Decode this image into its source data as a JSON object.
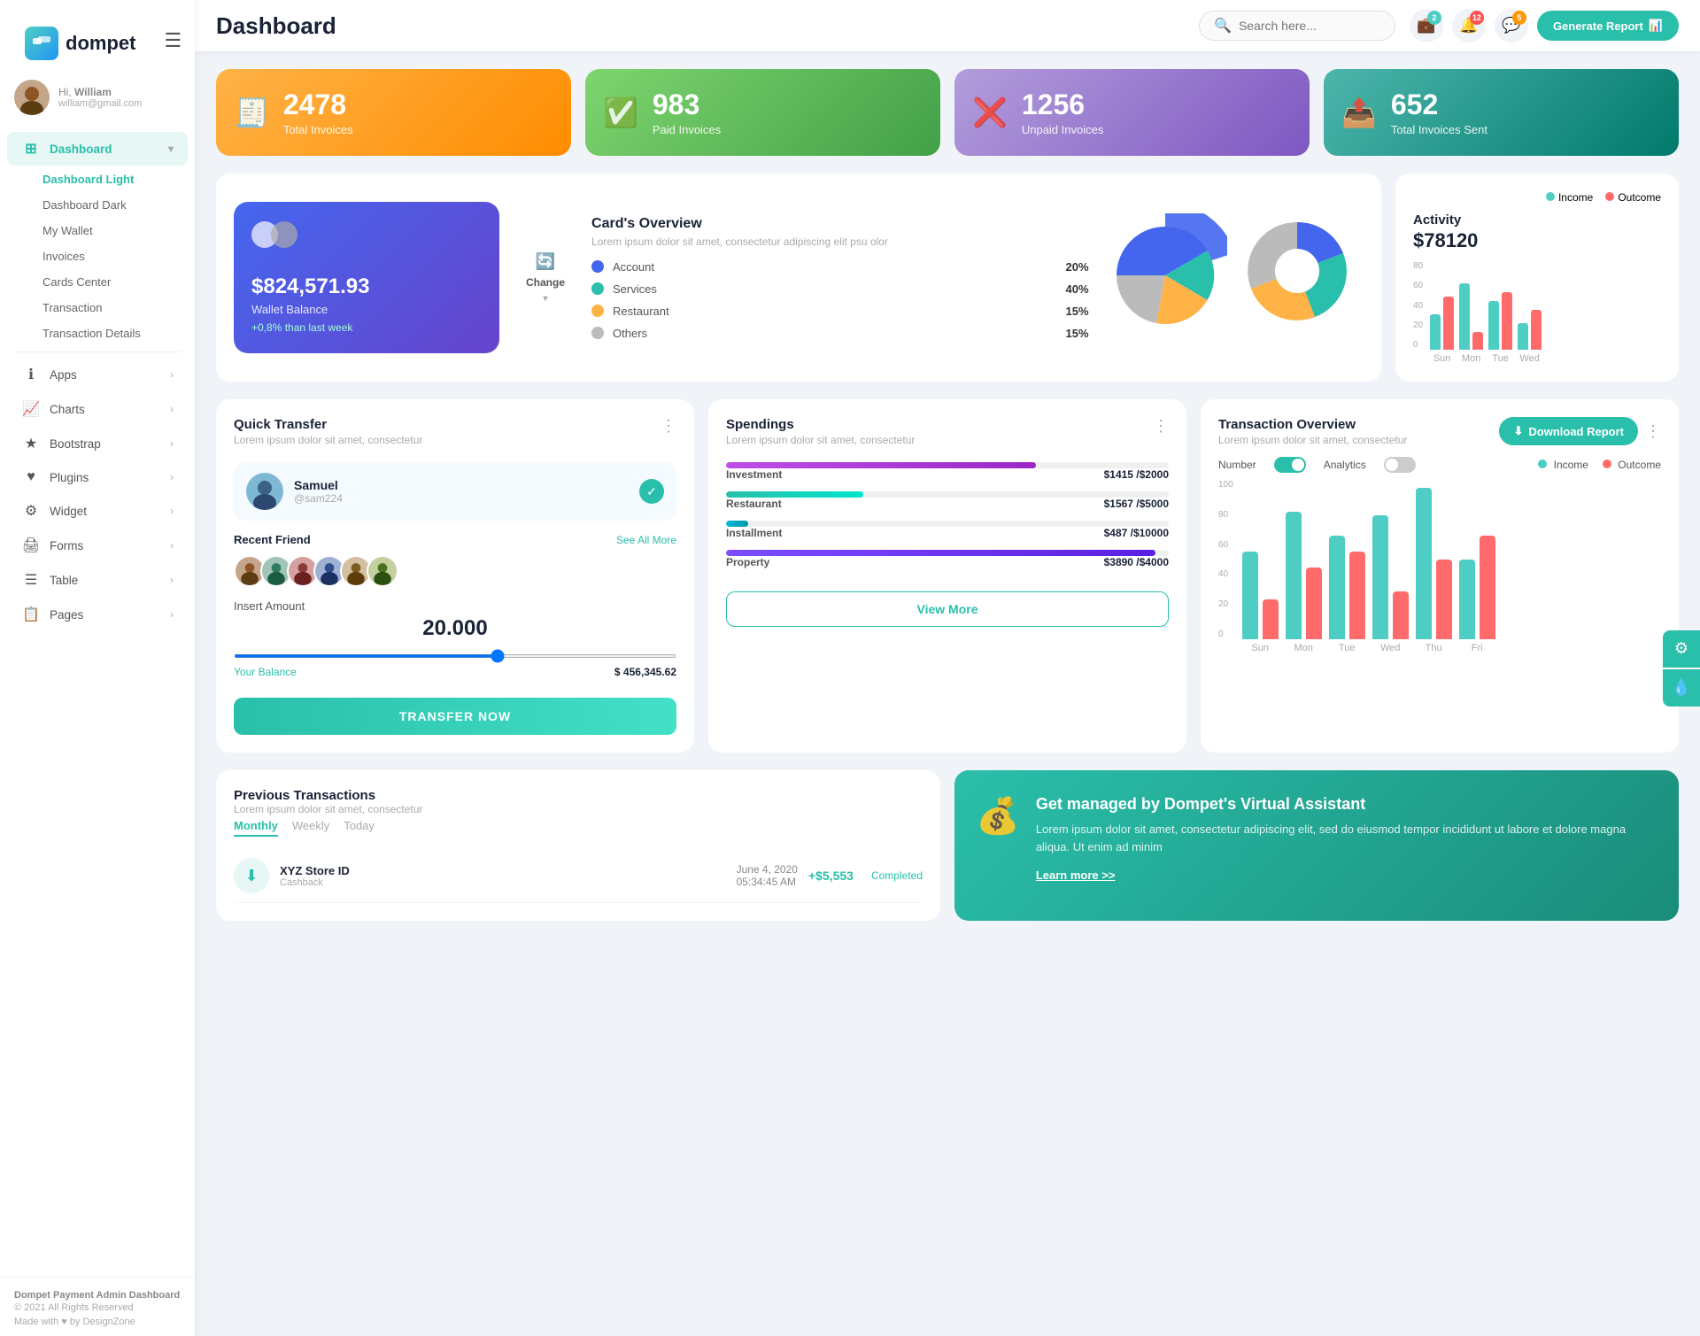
{
  "app": {
    "logo_text": "dompet",
    "title": "Dashboard"
  },
  "user": {
    "greeting": "Hi,",
    "name": "William",
    "email": "william@gmail.com"
  },
  "sidebar": {
    "nav_groups": [
      {
        "label": "Dashboard",
        "icon": "⊞",
        "active": true,
        "arrow": "▾",
        "sub_items": [
          {
            "label": "Dashboard Light",
            "active": true
          },
          {
            "label": "Dashboard Dark",
            "active": false
          },
          {
            "label": "My Wallet",
            "active": false
          },
          {
            "label": "Invoices",
            "active": false
          },
          {
            "label": "Cards Center",
            "active": false
          },
          {
            "label": "Transaction",
            "active": false
          },
          {
            "label": "Transaction Details",
            "active": false
          }
        ]
      },
      {
        "label": "Apps",
        "icon": "ℹ",
        "arrow": "›"
      },
      {
        "label": "Charts",
        "icon": "📈",
        "arrow": "›"
      },
      {
        "label": "Bootstrap",
        "icon": "★",
        "arrow": "›"
      },
      {
        "label": "Plugins",
        "icon": "♥",
        "arrow": "›"
      },
      {
        "label": "Widget",
        "icon": "⚙",
        "arrow": "›"
      },
      {
        "label": "Forms",
        "icon": "🖨",
        "arrow": "›"
      },
      {
        "label": "Table",
        "icon": "☰",
        "arrow": "›"
      },
      {
        "label": "Pages",
        "icon": "📋",
        "arrow": "›"
      }
    ],
    "footer": {
      "brand": "Dompet Payment Admin Dashboard",
      "copy": "© 2021 All Rights Reserved",
      "made": "Made with ♥ by DesignZone"
    }
  },
  "topbar": {
    "search_placeholder": "Search here...",
    "notifications": {
      "wallet": "2",
      "bell": "12",
      "chat": "5"
    },
    "generate_btn": "Generate Report"
  },
  "stats": [
    {
      "num": "2478",
      "label": "Total Invoices",
      "color": "orange",
      "icon": "🧾"
    },
    {
      "num": "983",
      "label": "Paid Invoices",
      "color": "green",
      "icon": "✅"
    },
    {
      "num": "1256",
      "label": "Unpaid Invoices",
      "color": "purple",
      "icon": "❌"
    },
    {
      "num": "652",
      "label": "Total Invoices Sent",
      "color": "blue",
      "icon": "📤"
    }
  ],
  "card_overview": {
    "wallet_amount": "$824,571.93",
    "wallet_label": "Wallet Balance",
    "wallet_change": "+0,8% than last week",
    "change_btn": "Change",
    "title": "Card's Overview",
    "desc": "Lorem ipsum dolor sit amet, consectetur adipiscing elit psu olor",
    "items": [
      {
        "label": "Account",
        "pct": "20%",
        "color": "#4466ee"
      },
      {
        "label": "Services",
        "pct": "40%",
        "color": "#2abfaa"
      },
      {
        "label": "Restaurant",
        "pct": "15%",
        "color": "#ffb347"
      },
      {
        "label": "Others",
        "pct": "15%",
        "color": "#bbb"
      }
    ]
  },
  "activity": {
    "title": "Activity",
    "amount": "$78120",
    "legend": {
      "income": "Income",
      "outcome": "Outcome"
    },
    "bars": [
      {
        "day": "Sun",
        "income": 40,
        "outcome": 60
      },
      {
        "day": "Mon",
        "income": 75,
        "outcome": 20
      },
      {
        "day": "Tue",
        "income": 55,
        "outcome": 65
      },
      {
        "day": "Wed",
        "income": 30,
        "outcome": 45
      }
    ]
  },
  "quick_transfer": {
    "title": "Quick Transfer",
    "desc": "Lorem ipsum dolor sit amet, consectetur",
    "contact_name": "Samuel",
    "contact_handle": "@sam224",
    "recent_label": "Recent Friend",
    "see_all": "See All More",
    "amount_label": "Insert Amount",
    "amount_value": "20.000",
    "balance_label": "Your Balance",
    "balance_value": "$ 456,345.62",
    "transfer_btn": "TRANSFER NOW"
  },
  "spendings": {
    "title": "Spendings",
    "desc": "Lorem ipsum dolor sit amet, consectetur",
    "items": [
      {
        "name": "Investment",
        "current": "$1415",
        "total": "$2000",
        "pct": 70,
        "color": "#c04de8"
      },
      {
        "name": "Restaurant",
        "current": "$1567",
        "total": "$5000",
        "pct": 31,
        "color": "#2abfaa"
      },
      {
        "name": "Installment",
        "current": "$487",
        "total": "$10000",
        "pct": 5,
        "color": "#00bcd4"
      },
      {
        "name": "Property",
        "current": "$3890",
        "total": "$4000",
        "pct": 97,
        "color": "#7c4dff"
      }
    ],
    "view_more": "View More"
  },
  "tx_overview": {
    "title": "Transaction Overview",
    "desc": "Lorem ipsum dolor sit amet, consectetur",
    "download_btn": "Download Report",
    "toggle_number": "Number",
    "toggle_analytics": "Analytics",
    "legend": {
      "income": "Income",
      "outcome": "Outcome"
    },
    "bars": [
      {
        "day": "Sun",
        "income": 55,
        "outcome": 25
      },
      {
        "day": "Mon",
        "income": 80,
        "outcome": 45
      },
      {
        "day": "Tue",
        "income": 65,
        "outcome": 55
      },
      {
        "day": "Wed",
        "income": 78,
        "outcome": 30
      },
      {
        "day": "Thu",
        "income": 95,
        "outcome": 50
      },
      {
        "day": "Fri",
        "income": 50,
        "outcome": 65
      }
    ]
  },
  "prev_transactions": {
    "title": "Previous Transactions",
    "desc": "Lorem ipsum dolor sit amet, consectetur",
    "tabs": [
      "Monthly",
      "Weekly",
      "Today"
    ],
    "active_tab": "Monthly",
    "rows": [
      {
        "icon": "⬇",
        "name": "XYZ Store ID",
        "type": "Cashback",
        "date": "June 4, 2020",
        "time": "05:34:45 AM",
        "amount": "+$5,553",
        "status": "Completed"
      }
    ]
  },
  "virtual_assistant": {
    "title": "Get managed by Dompet's Virtual Assistant",
    "desc": "Lorem ipsum dolor sit amet, consectetur adipiscing elit, sed do eiusmod tempor incididunt ut labore et dolore magna aliqua. Ut enim ad minim",
    "link": "Learn more >>"
  }
}
